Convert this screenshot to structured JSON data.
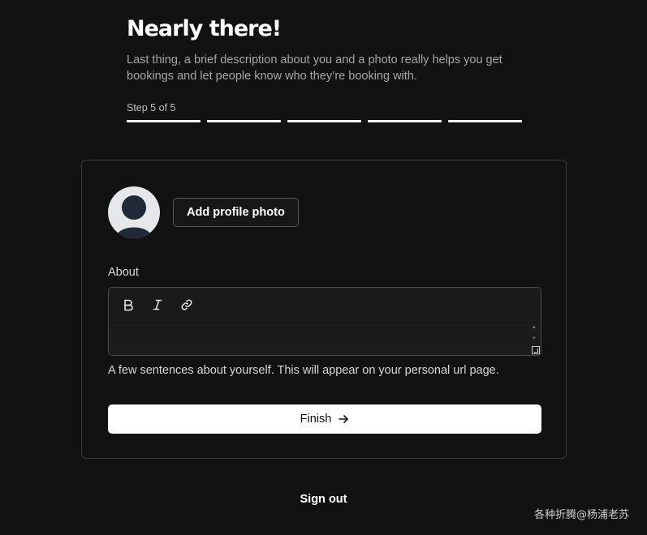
{
  "header": {
    "title": "Nearly there!",
    "subtitle_line1": "Last thing, a brief description about you and a photo really helps you get",
    "subtitle_line2": "bookings and let people know who they’re booking with.",
    "step_label": "Step 5 of 5",
    "steps_total": 5,
    "steps_completed": 5
  },
  "profile": {
    "avatar_icon": "user-silhouette-icon",
    "add_photo_label": "Add profile photo"
  },
  "about": {
    "label": "About",
    "value": "",
    "toolbar": {
      "bold_icon": "bold-icon",
      "italic_icon": "italic-icon",
      "link_icon": "link-icon"
    },
    "helper_text": "A few sentences about yourself. This will appear on your personal url page."
  },
  "finish": {
    "label": "Finish",
    "icon": "arrow-right-icon"
  },
  "sign_out_label": "Sign out",
  "watermark": "各种折腾@杨浦老苏",
  "colors": {
    "background": "#121212",
    "card_border": "#3a3a3a",
    "primary_button": "#ffffff",
    "avatar_bg": "#e5e7eb",
    "avatar_figure": "#1f2937"
  }
}
